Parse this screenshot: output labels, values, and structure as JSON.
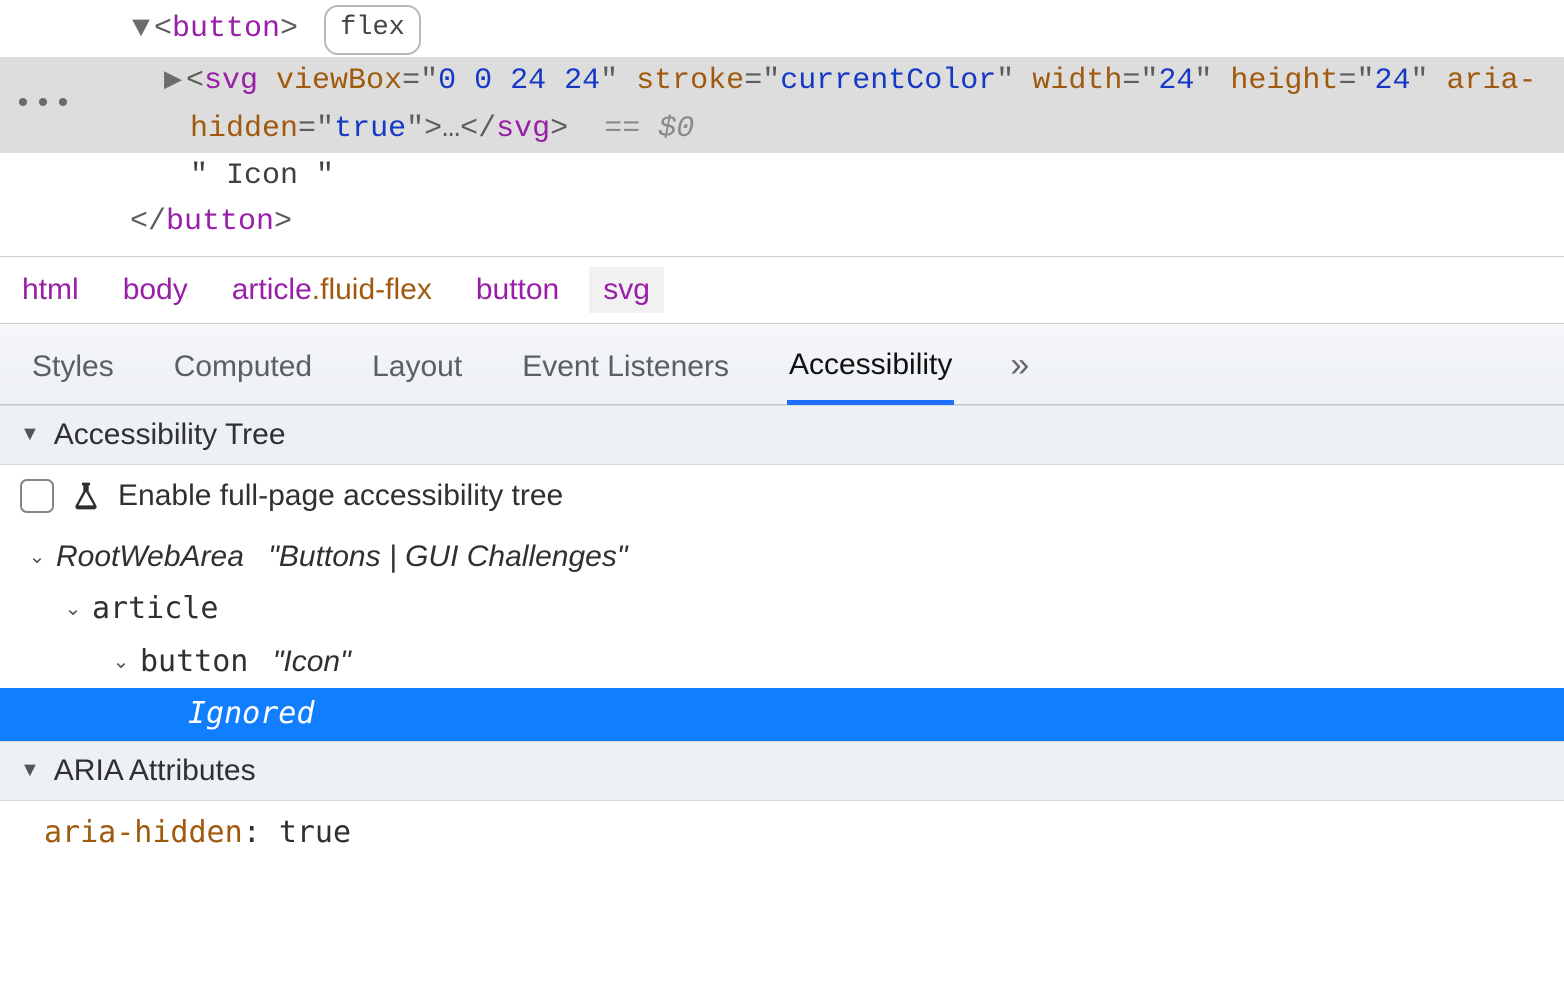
{
  "dom": {
    "flex_badge": "flex",
    "button_open": {
      "tag": "button"
    },
    "svg": {
      "tag": "svg",
      "attrs": [
        {
          "name": "viewBox",
          "value": "0 0 24 24"
        },
        {
          "name": "stroke",
          "value": "currentColor"
        },
        {
          "name": "width",
          "value": "24"
        },
        {
          "name": "height",
          "value": "24"
        },
        {
          "name": "aria-hidden",
          "value": "true"
        }
      ],
      "ellipsis": "…",
      "ref": "== $0"
    },
    "text_node": "\" Icon \"",
    "button_close": {
      "tag": "button"
    }
  },
  "breadcrumb": {
    "items": [
      {
        "label": "html"
      },
      {
        "label": "body"
      },
      {
        "label": "article",
        "class": ".fluid-flex"
      },
      {
        "label": "button"
      },
      {
        "label": "svg",
        "selected": true
      }
    ]
  },
  "tabs": {
    "items": [
      {
        "label": "Styles"
      },
      {
        "label": "Computed"
      },
      {
        "label": "Layout"
      },
      {
        "label": "Event Listeners"
      },
      {
        "label": "Accessibility",
        "active": true
      }
    ],
    "more": "»"
  },
  "ax": {
    "section_title": "Accessibility Tree",
    "enable_label": "Enable full-page accessibility tree",
    "tree": {
      "root_role": "RootWebArea",
      "root_name": "\"Buttons | GUI Challenges\"",
      "article_role": "article",
      "button_role": "button",
      "button_name": "\"Icon\"",
      "ignored_label": "Ignored"
    },
    "aria_section_title": "ARIA Attributes",
    "aria_attr_key": "aria-hidden",
    "aria_attr_val": "true"
  }
}
